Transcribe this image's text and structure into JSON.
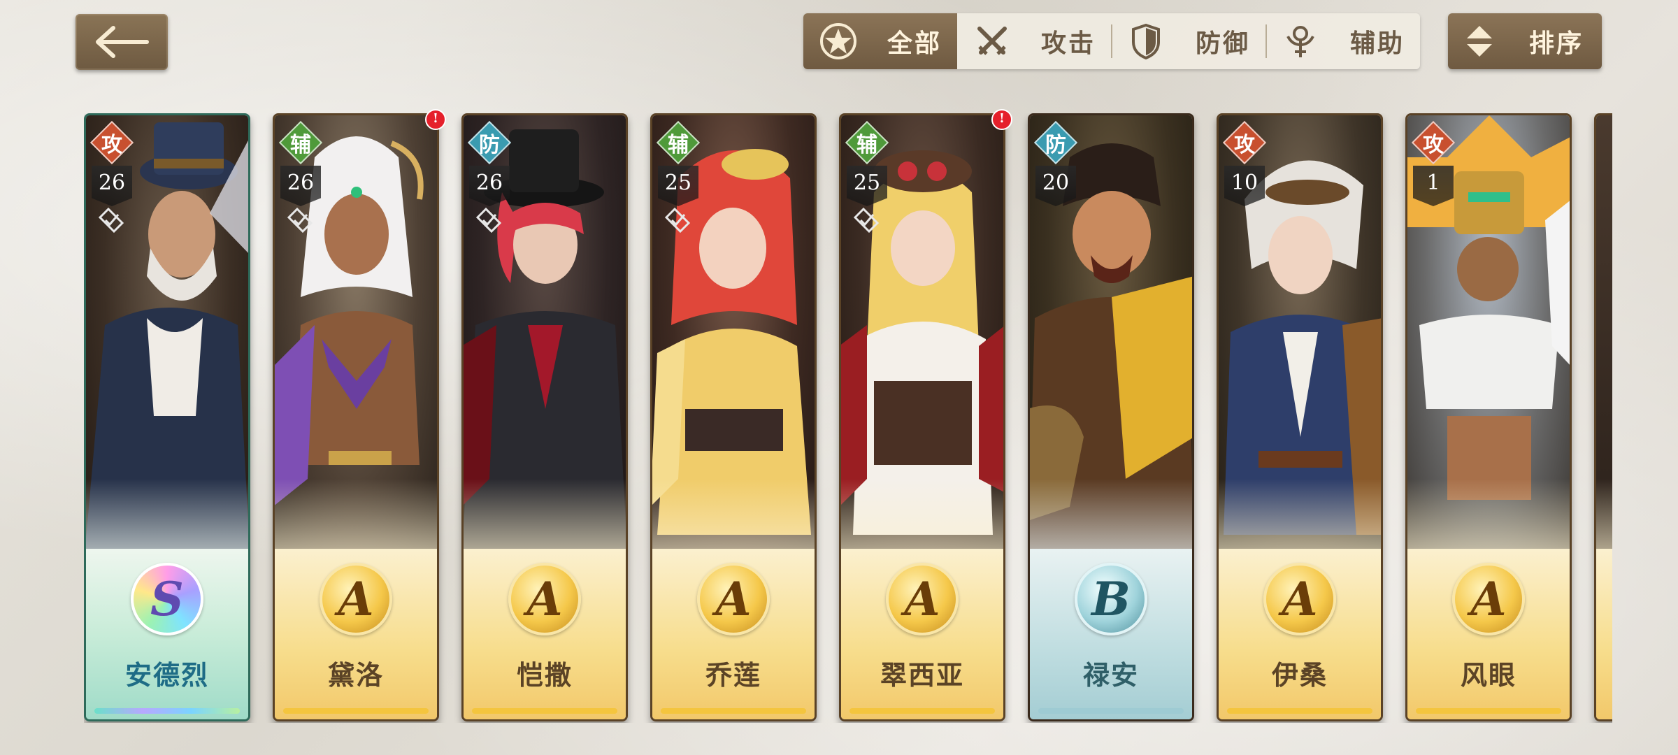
{
  "header": {
    "back_icon": "arrow-left-icon",
    "filters": [
      {
        "label": "全部",
        "icon": "star-icon",
        "active": true
      },
      {
        "label": "攻击",
        "icon": "crossed-swords-icon",
        "active": false
      },
      {
        "label": "防御",
        "icon": "shield-icon",
        "active": false
      },
      {
        "label": "辅助",
        "icon": "support-staff-icon",
        "active": false
      }
    ],
    "sort": {
      "label": "排序",
      "icon": "sort-arrows-icon"
    }
  },
  "colors": {
    "brown_button": "#7c6649",
    "attack": "#c8502f",
    "support": "#4f9a3a",
    "defense": "#3a9bb0",
    "notification": "#e5202b"
  },
  "characters": [
    {
      "name": "安德烈",
      "role": "攻",
      "level": "26",
      "rank": "S",
      "frame": "rainbow",
      "notification": false
    },
    {
      "name": "黛洛",
      "role": "辅",
      "level": "26",
      "rank": "A",
      "frame": "gold",
      "notification": true
    },
    {
      "name": "恺撒",
      "role": "防",
      "level": "26",
      "rank": "A",
      "frame": "gold",
      "notification": false
    },
    {
      "name": "乔莲",
      "role": "辅",
      "level": "25",
      "rank": "A",
      "frame": "gold",
      "notification": false
    },
    {
      "name": "翠西亚",
      "role": "辅",
      "level": "25",
      "rank": "A",
      "frame": "gold",
      "notification": true
    },
    {
      "name": "禄安",
      "role": "防",
      "level": "20",
      "rank": "B",
      "frame": "blue",
      "notification": false
    },
    {
      "name": "伊桑",
      "role": "攻",
      "level": "10",
      "rank": "A",
      "frame": "gold",
      "notification": false
    },
    {
      "name": "风眼",
      "role": "攻",
      "level": "1",
      "rank": "A",
      "frame": "gold",
      "notification": false
    }
  ]
}
